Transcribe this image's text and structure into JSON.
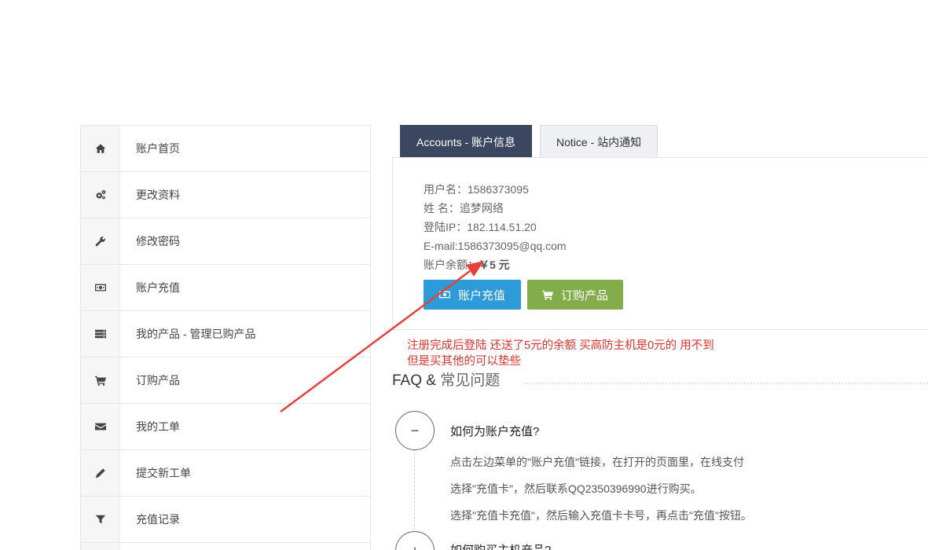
{
  "sidebar": {
    "items": [
      {
        "label": "账户首页",
        "icon": "home-icon"
      },
      {
        "label": "更改资料",
        "icon": "gears-icon"
      },
      {
        "label": "修改密码",
        "icon": "wrench-icon"
      },
      {
        "label": "账户充值",
        "icon": "money-icon"
      },
      {
        "label": "我的产品 - 管理已购产品",
        "icon": "server-icon"
      },
      {
        "label": "订购产品",
        "icon": "cart-icon"
      },
      {
        "label": "我的工单",
        "icon": "envelope-icon"
      },
      {
        "label": "提交新工单",
        "icon": "pencil-icon"
      },
      {
        "label": "充值记录",
        "icon": "filter-icon"
      }
    ]
  },
  "tabs": {
    "accounts": "Accounts - 账户信息",
    "notice": "Notice - 站内通知"
  },
  "account": {
    "username": "用户名：1586373095",
    "name": "姓 名：追梦网络",
    "ip": "登陆IP：182.114.51.20",
    "email": "E-mail:1586373095@qq.com",
    "balance_label": "账户余额：",
    "balance_value": "￥5 元"
  },
  "buttons": {
    "recharge": "账户充值",
    "order": "订购产品"
  },
  "annotation": {
    "line1": "注册完成后登陆 还送了5元的余额 买高防主机是0元的 用不到",
    "line2": "但是买其他的可以垫些",
    "color": "#e0322a"
  },
  "faq": {
    "title_en": "FAQ &",
    "title_cn": "常见问题",
    "items": [
      {
        "toggle": "−",
        "question": "如何为账户充值?",
        "answers": [
          "点击左边菜单的\"账户充值\"链接，在打开的页面里，在线支付",
          "选择\"充值卡\"，然后联系QQ2350396990进行购买。",
          "选择\"充值卡充值\"，然后输入充值卡卡号，再点击\"充值\"按钮。"
        ]
      },
      {
        "toggle": "+",
        "question": "如何购买主机产品?"
      }
    ]
  },
  "colors": {
    "tab_active": "#3b4761",
    "btn_blue": "#2d9ad9",
    "btn_green": "#83ac4b"
  }
}
